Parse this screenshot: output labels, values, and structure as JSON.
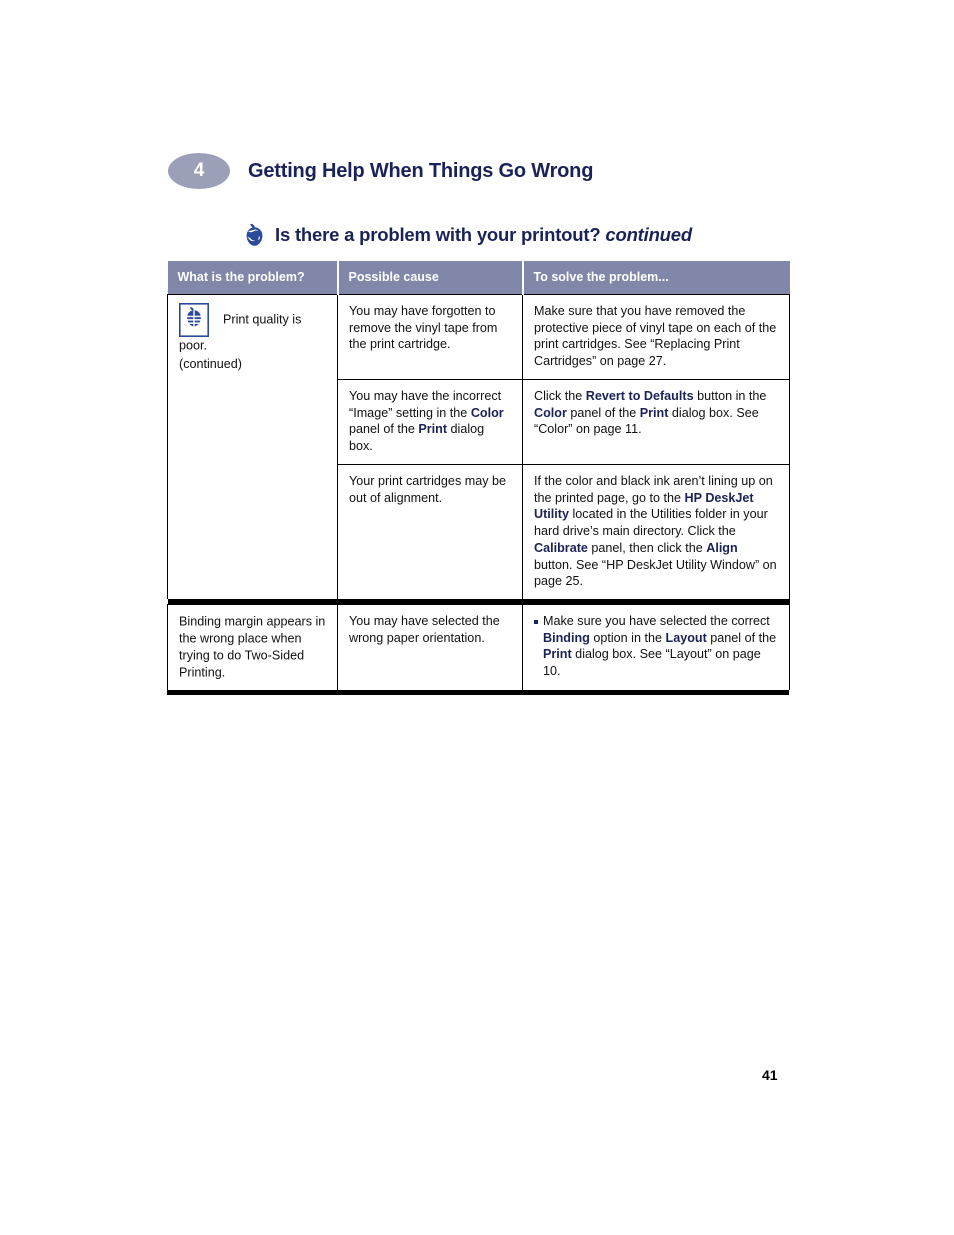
{
  "chapter": {
    "number": "4",
    "title": "Getting Help When Things Go Wrong"
  },
  "section": {
    "icon": "apple-logo-icon",
    "title": "Is there a problem with your printout?",
    "continued_label": "continued"
  },
  "table": {
    "headers": {
      "col1": "What is the problem?",
      "col2": "Possible cause",
      "col3": "To solve the problem..."
    },
    "rows": [
      {
        "problem": {
          "icon": "mac-print-icon",
          "label": "Print quality is poor.",
          "sub": "(continued)"
        },
        "entries": [
          {
            "cause_parts": [
              {
                "text": "You may have forgotten to remove the vinyl tape from the print cartridge.",
                "bold": false
              }
            ],
            "solution_parts": [
              {
                "text": "Make sure that you have removed the protective piece of vinyl tape on each of the print cartridges. See “Replacing Print Cartridges” on page 27.",
                "bold": false
              }
            ]
          },
          {
            "cause_parts": [
              {
                "text": "You may have the incorrect “Image” setting in the ",
                "bold": false
              },
              {
                "text": "Color",
                "bold": true
              },
              {
                "text": " panel of the ",
                "bold": false
              },
              {
                "text": "Print",
                "bold": true
              },
              {
                "text": " dialog box.",
                "bold": false
              }
            ],
            "solution_parts": [
              {
                "text": "Click the ",
                "bold": false
              },
              {
                "text": "Revert to Defaults",
                "bold": true
              },
              {
                "text": " button in the ",
                "bold": false
              },
              {
                "text": "Color",
                "bold": true
              },
              {
                "text": " panel of the ",
                "bold": false
              },
              {
                "text": "Print",
                "bold": true
              },
              {
                "text": " dialog box. See “Color” on page 11.",
                "bold": false
              }
            ]
          },
          {
            "cause_parts": [
              {
                "text": "Your print cartridges may be out of alignment.",
                "bold": false
              }
            ],
            "solution_parts": [
              {
                "text": "If the color and black ink aren’t lining up on the printed page, go to the ",
                "bold": false
              },
              {
                "text": "HP DeskJet Utility",
                "bold": true
              },
              {
                "text": " located in the Utilities folder in your hard drive’s main directory. Click the ",
                "bold": false
              },
              {
                "text": "Calibrate",
                "bold": true
              },
              {
                "text": " panel, then click the ",
                "bold": false
              },
              {
                "text": "Align",
                "bold": true
              },
              {
                "text": " button. See “HP DeskJet Utility Window” on page 25.",
                "bold": false
              }
            ]
          }
        ]
      },
      {
        "problem": {
          "icon": null,
          "label": "Binding margin appears in the wrong place when trying to do Two-Sided Printing.",
          "sub": null
        },
        "entries": [
          {
            "cause_parts": [
              {
                "text": "You may have selected the wrong paper orientation.",
                "bold": false
              }
            ],
            "bulleted": true,
            "solution_parts": [
              {
                "text": "Make sure you have selected the correct ",
                "bold": false
              },
              {
                "text": "Binding",
                "bold": true
              },
              {
                "text": " option in the ",
                "bold": false
              },
              {
                "text": "Layout",
                "bold": true
              },
              {
                "text": " panel of the ",
                "bold": false
              },
              {
                "text": "Print",
                "bold": true
              },
              {
                "text": " dialog box. See “Layout” on page 10.",
                "bold": false
              }
            ]
          }
        ]
      }
    ]
  },
  "footer": {
    "page_number": "41"
  },
  "colors": {
    "heading_navy": "#1b2257",
    "table_header_band": "#8187a8",
    "chapter_badge": "#9ba0b8",
    "icon_blue": "#2a4b9b"
  }
}
